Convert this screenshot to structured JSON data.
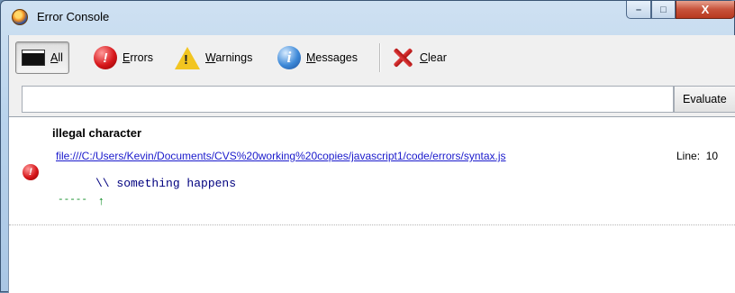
{
  "window": {
    "title": "Error Console"
  },
  "window_controls": {
    "minimize": "–",
    "maximize": "□",
    "close": "X"
  },
  "toolbar": {
    "buttons": [
      {
        "id": "all",
        "prefix": "",
        "underline": "A",
        "rest": "ll",
        "active": true
      },
      {
        "id": "errors",
        "prefix": "",
        "underline": "E",
        "rest": "rrors",
        "active": false
      },
      {
        "id": "warnings",
        "prefix": "",
        "underline": "W",
        "rest": "arnings",
        "active": false
      },
      {
        "id": "messages",
        "prefix": "",
        "underline": "M",
        "rest": "essages",
        "active": false
      },
      {
        "id": "clear",
        "prefix": "",
        "underline": "C",
        "rest": "lear",
        "active": false
      }
    ]
  },
  "evaluate": {
    "input_value": "",
    "button_label": "Evaluate"
  },
  "log": {
    "entries": [
      {
        "type": "error",
        "icon_glyph": "!",
        "title": "illegal character",
        "source_url": "file:///C:/Users/Kevin/Documents/CVS%20working%20copies/javascript1/code/errors/syntax.js",
        "line_label": "Line:  10",
        "code": "\\\\ something happens",
        "marker": "-----",
        "arrow": "↑"
      }
    ]
  }
}
